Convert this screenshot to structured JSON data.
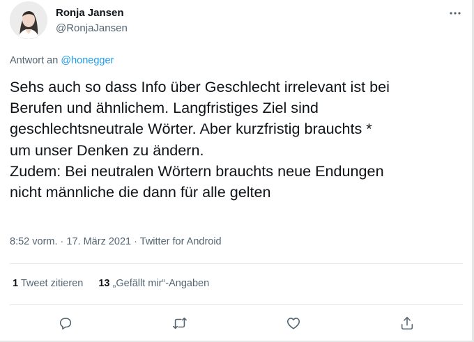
{
  "author": {
    "display_name": "Ronja Jansen",
    "handle": "@RonjaJansen"
  },
  "reply": {
    "prefix": "Antwort an",
    "mention": "@honegger"
  },
  "tweet": {
    "text": "Sehs auch so dass Info über Geschlecht irrelevant ist bei\nBerufen und ähnlichem. Langfristiges Ziel sind\ngeschlechtsneutrale Wörter. Aber kurzfristig brauchts *\num unser Denken zu ändern.\nZudem: Bei neutralen Wörtern brauchts neue Endungen\nnicht männliche die dann für alle gelten"
  },
  "meta": {
    "time": "8:52 vorm.",
    "separator1": "·",
    "date": "17. März 2021",
    "separator2": "·",
    "source": "Twitter for Android"
  },
  "stats": {
    "retweet_count": "1",
    "retweet_label": "Tweet zitieren",
    "like_count": "13",
    "like_label": "„Gefällt mir“-Angaben"
  },
  "icons": {
    "more": "more-horizontal-icon",
    "reply": "reply-icon",
    "retweet": "retweet-icon",
    "like": "heart-icon",
    "share": "share-icon"
  },
  "colors": {
    "text": "#0f1419",
    "secondary": "#536471",
    "link": "#1d9bf0",
    "divider": "#e7e9ea"
  }
}
